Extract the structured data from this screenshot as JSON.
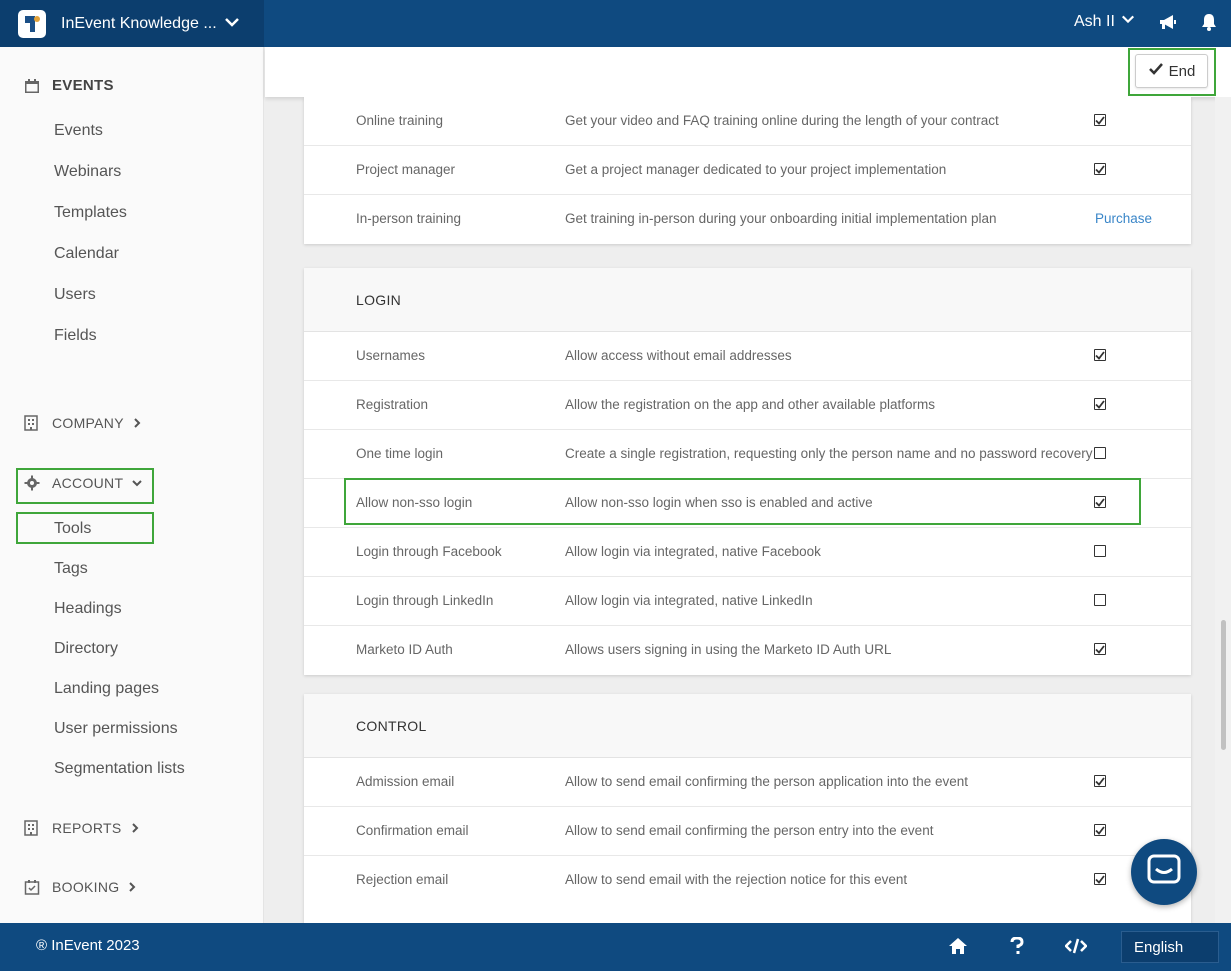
{
  "app": {
    "title": "InEvent Knowledge ...",
    "user_name": "Ash II",
    "colors": {
      "primary": "#0f4a80",
      "highlight": "#3fa63a",
      "link": "#3a86c8"
    }
  },
  "header": {
    "end_label": "End"
  },
  "sidebar": {
    "events_heading": "EVENTS",
    "events_items": [
      "Events",
      "Webinars",
      "Templates",
      "Calendar",
      "Users",
      "Fields"
    ],
    "company_heading": "COMPANY",
    "account_heading": "ACCOUNT",
    "account_items": [
      "Tools",
      "Tags",
      "Headings",
      "Directory",
      "Landing pages",
      "User permissions",
      "Segmentation lists"
    ],
    "reports_heading": "REPORTS",
    "booking_heading": "BOOKING"
  },
  "content": {
    "top_card_rows": [
      {
        "name": "Online training",
        "desc": "Get your video and FAQ training online during the length of your contract",
        "checked": true
      },
      {
        "name": "Project manager",
        "desc": "Get a project manager dedicated to your project implementation",
        "checked": true
      },
      {
        "name": "In-person training",
        "desc": "Get training in-person during your onboarding initial implementation plan",
        "action": "Purchase"
      }
    ],
    "login_title": "LOGIN",
    "login_rows": [
      {
        "name": "Usernames",
        "desc": "Allow access without email addresses",
        "checked": true
      },
      {
        "name": "Registration",
        "desc": "Allow the registration on the app and other available platforms",
        "checked": true
      },
      {
        "name": "One time login",
        "desc": "Create a single registration, requesting only the person name and no password recovery",
        "checked": false
      },
      {
        "name": "Allow non-sso login",
        "desc": "Allow non-sso login when sso is enabled and active",
        "checked": true
      },
      {
        "name": "Login through Facebook",
        "desc": "Allow login via integrated, native Facebook",
        "checked": false
      },
      {
        "name": "Login through LinkedIn",
        "desc": "Allow login via integrated, native LinkedIn",
        "checked": false
      },
      {
        "name": "Marketo ID Auth",
        "desc": "Allows users signing in using the Marketo ID Auth URL",
        "checked": true
      }
    ],
    "control_title": "CONTROL",
    "control_rows": [
      {
        "name": "Admission email",
        "desc": "Allow to send email confirming the person application into the event",
        "checked": true
      },
      {
        "name": "Confirmation email",
        "desc": "Allow to send email confirming the person entry into the event",
        "checked": true
      },
      {
        "name": "Rejection email",
        "desc": "Allow to send email with the rejection notice for this event",
        "checked": true
      }
    ]
  },
  "footer": {
    "copyright": "® InEvent 2023",
    "language": "English"
  }
}
